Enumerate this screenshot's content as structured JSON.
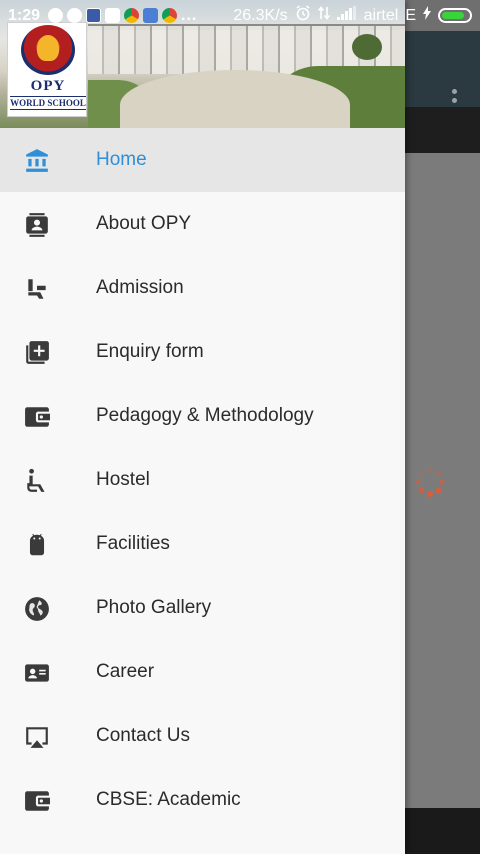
{
  "status_bar": {
    "time": "1:29",
    "overflow": "...",
    "speed": "26.3K/s",
    "carrier": "airtel",
    "network": "E",
    "battery_level": 0.85,
    "notification_icons": [
      "whatsapp-icon",
      "phone-icon",
      "facebook-icon",
      "gmail-icon",
      "chrome-icon",
      "app-icon",
      "chrome-icon"
    ]
  },
  "header": {
    "logo_title": "OPY",
    "logo_subtitle": "WORLD SCHOOL"
  },
  "menu": {
    "items": [
      {
        "label": "Home",
        "icon": "bank-icon",
        "active": true
      },
      {
        "label": "About OPY",
        "icon": "contact-card-icon",
        "active": false
      },
      {
        "label": "Admission",
        "icon": "seat-icon",
        "active": false
      },
      {
        "label": "Enquiry form",
        "icon": "add-box-icon",
        "active": false
      },
      {
        "label": "Pedagogy & Methodology",
        "icon": "wallet-icon",
        "active": false
      },
      {
        "label": "Hostel",
        "icon": "accessible-icon",
        "active": false
      },
      {
        "label": "Facilities",
        "icon": "android-icon",
        "active": false
      },
      {
        "label": "Photo Gallery",
        "icon": "globe-icon",
        "active": false
      },
      {
        "label": "Career",
        "icon": "contact-mail-icon",
        "active": false
      },
      {
        "label": "Contact Us",
        "icon": "airplay-icon",
        "active": false
      },
      {
        "label": "CBSE: Academic",
        "icon": "wallet-icon",
        "active": false
      }
    ]
  },
  "colors": {
    "active_text": "#2f8fd8",
    "toolbar": "#2a3a40",
    "drawer_bg": "#f8f8f8",
    "active_row": "#e6e6e6"
  }
}
